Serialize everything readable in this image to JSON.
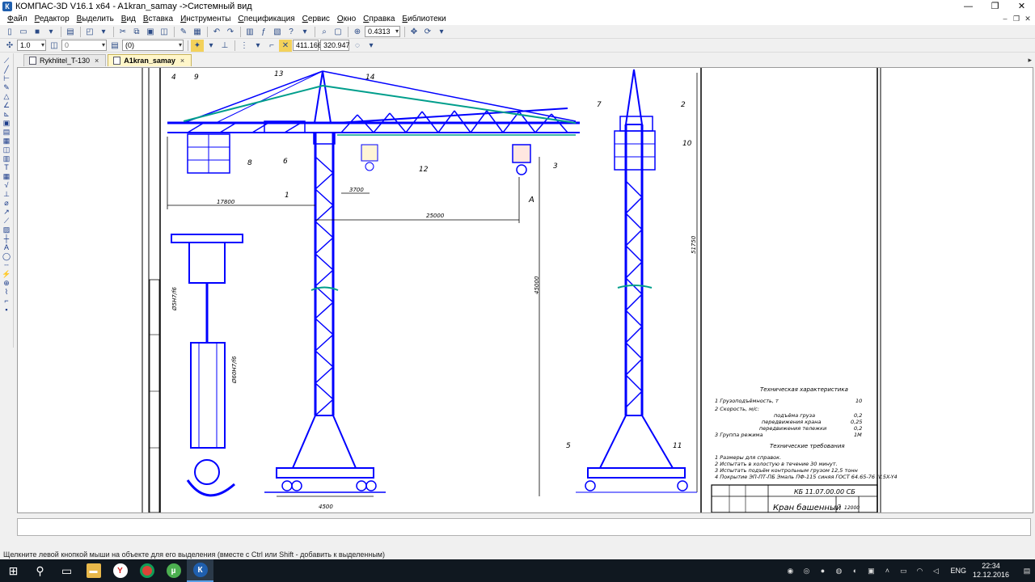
{
  "window": {
    "title": "КОМПАС-3D V16.1 x64 - A1kran_samay ->Системный вид",
    "controls": {
      "minimize": "—",
      "restore": "❐",
      "close": "✕"
    }
  },
  "menu": {
    "items": [
      "Файл",
      "Редактор",
      "Выделить",
      "Вид",
      "Вставка",
      "Инструменты",
      "Спецификация",
      "Сервис",
      "Окно",
      "Справка",
      "Библиотеки"
    ]
  },
  "toolbar1": {
    "zoom_value": "0.4313"
  },
  "toolbar2": {
    "scale_value": "1.0",
    "style_value": "0",
    "layer_value": "(0)",
    "coord_x": "411.166",
    "coord_y": "320.947"
  },
  "tabs": [
    {
      "label": "Rykhlitel_T-130",
      "active": false
    },
    {
      "label": "A1kran_samay",
      "active": true
    }
  ],
  "drawing": {
    "callouts": {
      "n4": "4",
      "n9": "9",
      "n13": "13",
      "n14": "14",
      "n8": "8",
      "n6": "6",
      "n12": "12",
      "n1": "1",
      "n3": "3",
      "n7": "7",
      "n2": "2",
      "n10": "10",
      "n5": "5",
      "n11": "11"
    },
    "dimensions": {
      "d17800": "17800",
      "d3700": "3700",
      "d25000": "25000",
      "d45000": "45000",
      "d51750": "51750",
      "d4500": "4500",
      "view_a": "А"
    },
    "tech_spec": {
      "title": "Техническая характеристика",
      "line1_label": "1  Грузоподъёмность, т",
      "line1_value": "10",
      "line2_label": "2  Скорость, м/с:",
      "line3_label": "подъёма груза",
      "line3_value": "0,2",
      "line4_label": "передвижения крана",
      "line4_value": "0,25",
      "line5_label": "передвижения тележки",
      "line5_value": "0,2",
      "line6_label": "3  Группа режима",
      "line6_value": "1М"
    },
    "tech_req": {
      "title": "Технические требования",
      "line1": "1  Размеры для справок.",
      "line2": "2  Испытать в холостую в течение 30 минут.",
      "line3": "3  Испытать подъём контрольным грузом 12,5 тонн",
      "line4": "4  Покрытие ЭП-ПТ-ПБ Эмаль ПФ-115 синяя ГОСТ 64.65-76 IV.5X-Y4"
    },
    "title_block": {
      "designation": "КБ 11.07.00.00 СБ",
      "name": "Кран башенный",
      "sheet_code": "12000"
    },
    "left_view": {
      "dim1": "Ø5Н7/f6",
      "dim2": "Ø60Н7/f6"
    }
  },
  "status_bar": {
    "hint": "Щелкните левой кнопкой мыши на объекте для его выделения (вместе с Ctrl или Shift - добавить к выделенным)"
  },
  "taskbar": {
    "lang": "ENG",
    "time": "22:34",
    "date": "12.12.2016"
  },
  "colors": {
    "drawing_blue": "#0000ff",
    "drawing_teal": "#009e8c",
    "tab_active": "#fff6c9",
    "taskbar": "#101820"
  }
}
